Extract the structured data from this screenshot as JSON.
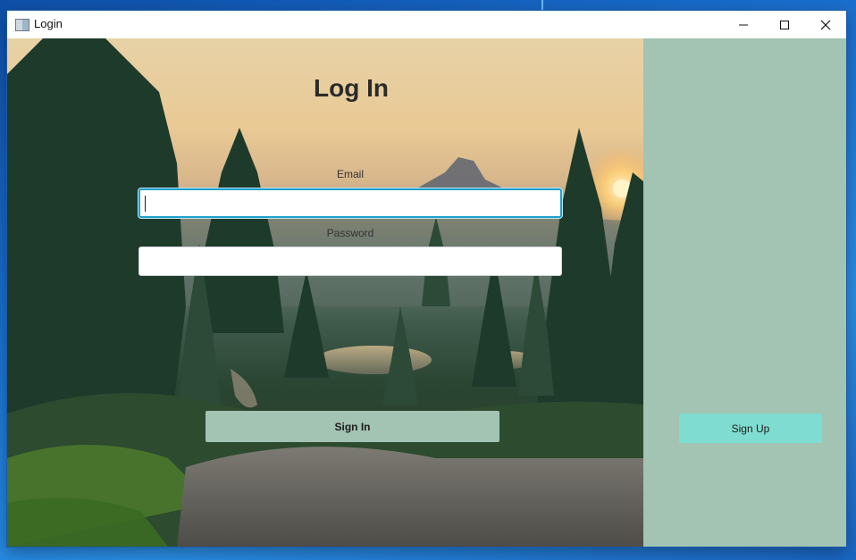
{
  "window": {
    "title": "Login",
    "icon": "app-window-icon",
    "controls": {
      "minimize": "minimize-icon",
      "maximize": "maximize-icon",
      "close": "close-icon"
    }
  },
  "form": {
    "heading": "Log In",
    "email_label": "Email",
    "email_value": "",
    "password_label": "Password",
    "password_value": "",
    "signin_label": "Sign In"
  },
  "side_panel": {
    "signup_label": "Sign Up"
  },
  "colors": {
    "side_panel": "#a3c3b3",
    "signin_button": "#a3c3b3",
    "signup_button": "#7fdcd0",
    "focus_border": "#1ea0c8"
  }
}
